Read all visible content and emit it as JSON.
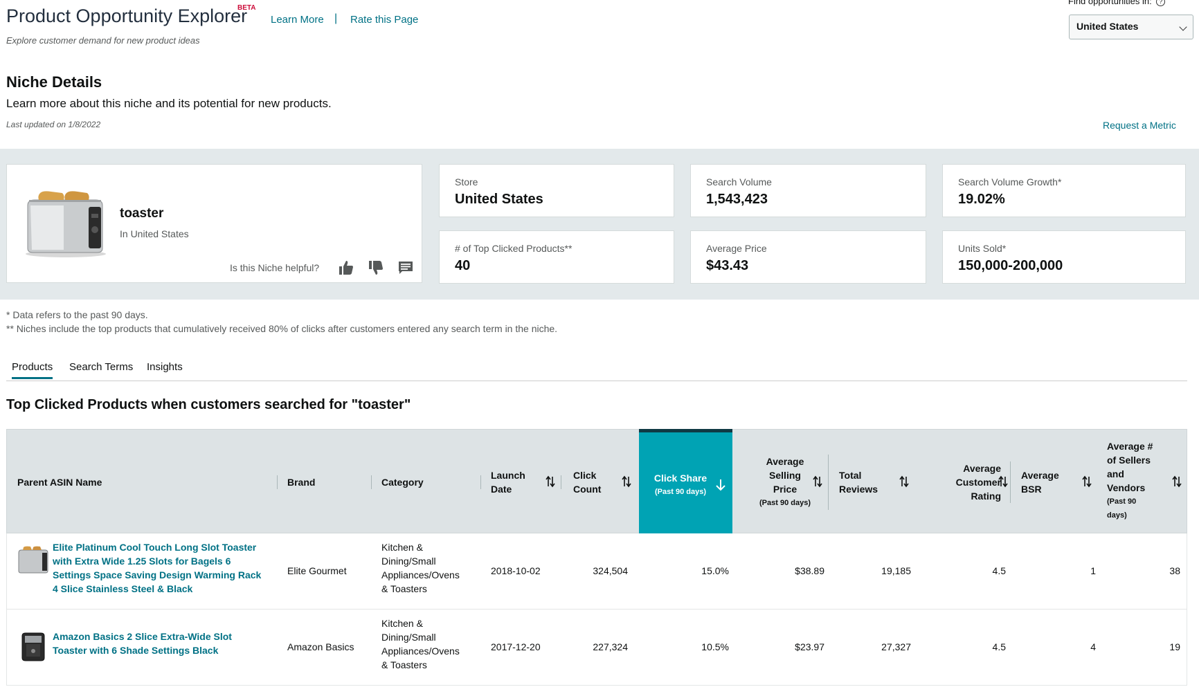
{
  "header": {
    "app_title": "Product Opportunity Explorer",
    "beta": "BETA",
    "learn_more": "Learn More",
    "separator": "|",
    "rate_page": "Rate this Page",
    "subtitle": "Explore customer demand for new product ideas",
    "find_label": "Find opportunities in:",
    "help_glyph": "?",
    "country": "United States"
  },
  "niche": {
    "heading": "Niche Details",
    "description": "Learn more about this niche and its potential for new products.",
    "last_updated": "Last updated on 1/8/2022",
    "request_metric": "Request a Metric",
    "name": "toaster",
    "location": "In United States",
    "helpful_prompt": "Is this Niche helpful?"
  },
  "metrics": [
    {
      "label": "Store",
      "value": "United States"
    },
    {
      "label": "Search Volume",
      "value": "1,543,423"
    },
    {
      "label": "Search Volume Growth*",
      "value": "19.02%"
    },
    {
      "label": "# of Top Clicked Products**",
      "value": "40"
    },
    {
      "label": "Average Price",
      "value": "$43.43"
    },
    {
      "label": "Units Sold*",
      "value": "150,000-200,000"
    }
  ],
  "notes": [
    "* Data refers to the past 90 days.",
    "** Niches include the top products that cumulatively received 80% of clicks after customers entered any search term in the niche."
  ],
  "tabs": [
    "Products",
    "Search Terms",
    "Insights"
  ],
  "section_title": "Top Clicked Products when customers searched for \"toaster\"",
  "table": {
    "headers": {
      "parent_asin": "Parent ASIN Name",
      "brand": "Brand",
      "category": "Category",
      "launch_1": "Launch",
      "launch_2": "Date",
      "click_count_1": "Click",
      "click_count_2": "Count",
      "click_share": "Click Share",
      "click_share_sub": "(Past 90 days)",
      "asp_1": "Average",
      "asp_2": "Selling",
      "asp_3": "Price",
      "asp_sub": "(Past 90 days)",
      "reviews_1": "Total",
      "reviews_2": "Reviews",
      "rating_1": "Average",
      "rating_2": "Customer",
      "rating_3": "Rating",
      "bsr_1": "Average",
      "bsr_2": "BSR",
      "sellers_1": "Average #",
      "sellers_2": "of Sellers",
      "sellers_3": "and",
      "sellers_4": "Vendors",
      "sellers_sub_1": "(Past 90",
      "sellers_sub_2": "days)"
    },
    "rows": [
      {
        "name_lines": [
          "Elite Platinum Cool Touch Long Slot Toaster",
          "with Extra Wide 1.25 Slots for Bagels 6",
          "Settings Space Saving Design Warming Rack",
          "4 Slice Stainless Steel & Black"
        ],
        "brand": "Elite Gourmet",
        "category_lines": [
          "Kitchen &",
          "Dining/Small",
          "Appliances/Ovens",
          "& Toasters"
        ],
        "launch_date": "2018-10-02",
        "click_count": "324,504",
        "click_share": "15.0%",
        "avg_price": "$38.89",
        "total_reviews": "19,185",
        "rating": "4.5",
        "bsr": "1",
        "sellers": "38"
      },
      {
        "name_lines": [
          "Amazon Basics 2 Slice Extra-Wide Slot",
          "Toaster with 6 Shade Settings Black"
        ],
        "brand": "Amazon Basics",
        "category_lines": [
          "Kitchen &",
          "Dining/Small",
          "Appliances/Ovens",
          "& Toasters"
        ],
        "launch_date": "2017-12-20",
        "click_count": "227,324",
        "click_share": "10.5%",
        "avg_price": "$23.97",
        "total_reviews": "27,327",
        "rating": "4.5",
        "bsr": "4",
        "sellers": "19"
      }
    ]
  },
  "colors": {
    "link": "#007185",
    "accent_header": "#00a3b4",
    "panel_bg": "#e3e9eb",
    "beta": "#cc0c39"
  }
}
